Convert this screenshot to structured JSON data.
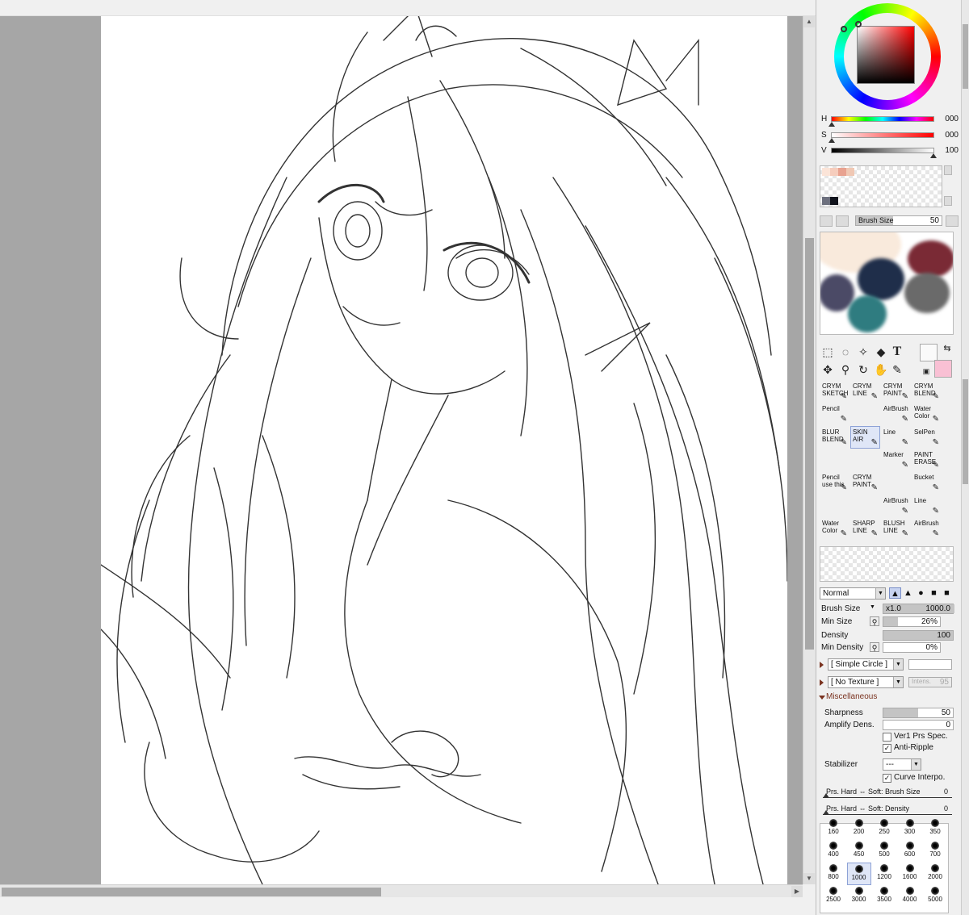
{
  "color": {
    "h_label": "H",
    "h_value": "000",
    "s_label": "S",
    "s_value": "000",
    "v_label": "V",
    "v_value": "100",
    "fg": "#fafafa",
    "bg": "#f9c0d4"
  },
  "swatches": [
    "#fbe4d8",
    "#f6cdbd",
    "#e8a290",
    "#f0c8b4",
    "#6d707e",
    "#10131c"
  ],
  "brush_size_bar": {
    "label": "Brush Size",
    "value": "50"
  },
  "scratch_blobs": [
    "#f9eadc",
    "#7a2a35",
    "#1f2e4a",
    "#4b4a66",
    "#6a6a6a",
    "#2f7c80"
  ],
  "tools": [
    "select-rect",
    "lasso",
    "magic-wand",
    "shape",
    "text",
    "move",
    "zoom",
    "rotate",
    "hand",
    "eyedropper"
  ],
  "tool_text_glyph": "T",
  "brushes": [
    {
      "label": "CRYM\nSKETCH"
    },
    {
      "label": "CRYM\nLINE"
    },
    {
      "label": "CRYM\nPAINT"
    },
    {
      "label": "CRYM\nBLEND"
    },
    {
      "label": "Pencil"
    },
    {
      "label": ""
    },
    {
      "label": "AirBrush"
    },
    {
      "label": "Water\nColor"
    },
    {
      "label": "BLUR\nBLEND"
    },
    {
      "label": "SKIN\nAIR",
      "selected": true
    },
    {
      "label": "Line"
    },
    {
      "label": "SelPen"
    },
    {
      "label": ""
    },
    {
      "label": ""
    },
    {
      "label": "Marker"
    },
    {
      "label": "PAINT\nERASE"
    },
    {
      "label": "Pencil\nuse this"
    },
    {
      "label": "CRYM\nPAINT"
    },
    {
      "label": ""
    },
    {
      "label": "Bucket"
    },
    {
      "label": ""
    },
    {
      "label": ""
    },
    {
      "label": "AirBrush"
    },
    {
      "label": "Line"
    },
    {
      "label": "Water\nColor"
    },
    {
      "label": "SHARP\nLINE"
    },
    {
      "label": "BLUSH\nLINE"
    },
    {
      "label": "AirBrush"
    }
  ],
  "blend_mode": "Normal",
  "brush_props": {
    "brush_size_label": "Brush Size",
    "multiplier": "x1.0",
    "brush_size_value": "1000.0",
    "min_size_label": "Min Size",
    "min_size_value": "26%",
    "density_label": "Density",
    "density_value": "100",
    "min_density_label": "Min Density",
    "min_density_value": "0%"
  },
  "brush_shape": "[ Simple Circle ]",
  "texture": "[ No Texture ]",
  "texture_intensity": "Intens.",
  "texture_intensity_value": "95",
  "misc": {
    "header": "Miscellaneous",
    "sharpness_label": "Sharpness",
    "sharpness_value": "50",
    "amplify_label": "Amplify Dens.",
    "amplify_value": "0",
    "ver1_label": "Ver1 Prs Spec.",
    "ver1_checked": false,
    "antiripple_label": "Anti-Ripple",
    "antiripple_checked": true,
    "stabilizer_label": "Stabilizer",
    "stabilizer_value": "---",
    "curve_label": "Curve Interpo.",
    "curve_checked": true,
    "prs_size_label": "Prs. Hard ⇔ Soft: Brush Size",
    "prs_size_value": "0",
    "prs_density_label": "Prs. Hard ⇔ Soft: Density",
    "prs_density_value": "0"
  },
  "sizes": [
    "160",
    "200",
    "250",
    "300",
    "350",
    "400",
    "450",
    "500",
    "600",
    "700",
    "800",
    "1000",
    "1200",
    "1600",
    "2000",
    "2500",
    "3000",
    "3500",
    "4000",
    "5000"
  ],
  "selected_size": "1000"
}
